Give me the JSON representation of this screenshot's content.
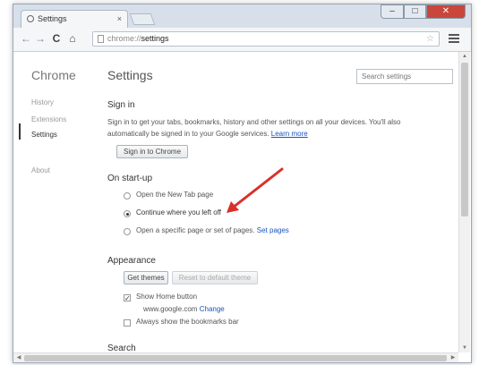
{
  "tab": {
    "title": "Settings",
    "close": "×"
  },
  "window_controls": {
    "close_glyph": "✕"
  },
  "toolbar": {
    "url_scheme": "chrome://",
    "url_path": "settings"
  },
  "sidebar": {
    "heading": "Chrome",
    "items": [
      {
        "label": "History"
      },
      {
        "label": "Extensions"
      },
      {
        "label": "Settings"
      },
      {
        "label": "About"
      }
    ]
  },
  "main": {
    "title": "Settings",
    "search_placeholder": "Search settings",
    "signin": {
      "title": "Sign in",
      "text_line1": "Sign in to get your tabs, bookmarks, history and other settings on all your devices. You'll also",
      "text_line2": "automatically be signed in to your Google services.",
      "learn_more": "Learn more",
      "button": "Sign in to Chrome"
    },
    "startup": {
      "title": "On start-up",
      "options": [
        {
          "label": "Open the New Tab page",
          "selected": false
        },
        {
          "label": "Continue where you left off",
          "selected": true
        },
        {
          "label": "Open a specific page or set of pages.",
          "selected": false
        }
      ],
      "set_pages": "Set pages"
    },
    "appearance": {
      "title": "Appearance",
      "get_themes": "Get themes",
      "reset_theme": "Reset to default theme",
      "show_home": {
        "label": "Show Home button",
        "checked": true
      },
      "home_url": "www.google.com",
      "change": "Change",
      "bookmarks_bar": {
        "label": "Always show the bookmarks bar",
        "checked": false
      }
    },
    "search": {
      "title": "Search"
    }
  },
  "colors": {
    "accent_link": "#1a55c0",
    "annotation_arrow": "#d9302a",
    "close_button": "#c9463d"
  },
  "icons": [
    "settings-tab-icon",
    "back-icon",
    "forward-icon",
    "reload-icon",
    "home-icon",
    "page-icon",
    "star-icon",
    "menu-icon"
  ]
}
